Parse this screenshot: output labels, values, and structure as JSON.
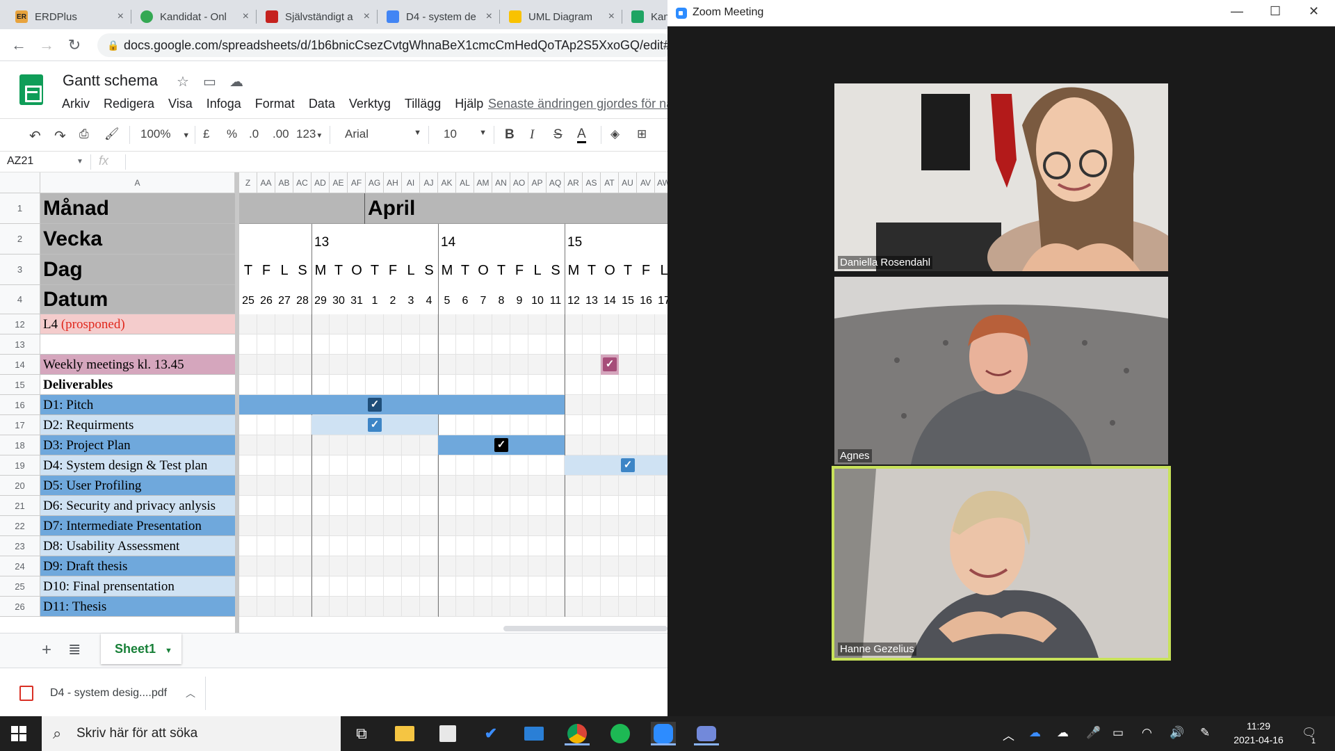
{
  "browser": {
    "tabs": [
      {
        "icon_text": "ER",
        "icon_color": "#e8a33d",
        "title": "ERDPlus"
      },
      {
        "icon_text": "",
        "icon_color": "#34a853",
        "title": "Kandidat - Onl"
      },
      {
        "icon_text": "",
        "icon_color": "#c5221f",
        "title": "Självständigt a"
      },
      {
        "icon_text": "",
        "icon_color": "#4285f4",
        "title": "D4 - system de"
      },
      {
        "icon_text": "",
        "icon_color": "#f9c200",
        "title": "UML Diagram"
      },
      {
        "icon_text": "",
        "icon_color": "#1fa463",
        "title": "Kan"
      }
    ],
    "url": "docs.google.com/spreadsheets/d/1b6bnicCsezCvtgWhnaBeX1cmcCmHedQoTAp2S5XxoGQ/edit#gid="
  },
  "sheets": {
    "doc_title": "Gantt schema",
    "menu": [
      "Arkiv",
      "Redigera",
      "Visa",
      "Infoga",
      "Format",
      "Data",
      "Verktyg",
      "Tillägg",
      "Hjälp"
    ],
    "last_edit": "Senaste ändringen gjordes för nå",
    "toolbar": {
      "zoom": "100%",
      "currency": "£",
      "percent": "%",
      "dec_less": ".0",
      "dec_more": ".00",
      "format": "123",
      "font": "Arial",
      "size": "10",
      "bold": "B",
      "italic": "I",
      "strike": "S",
      "text_color": "A"
    },
    "cell_ref": "AZ21",
    "fx": "fx",
    "col_a_label": "A",
    "col_headers": [
      "Z",
      "AA",
      "AB",
      "AC",
      "AD",
      "AE",
      "AF",
      "AG",
      "AH",
      "AI",
      "AJ",
      "AK",
      "AL",
      "AM",
      "AN",
      "AO",
      "AP",
      "AQ",
      "AR",
      "AS",
      "AT",
      "AU",
      "AV",
      "AW"
    ],
    "header_rows": [
      {
        "num": "1",
        "label": "Månad"
      },
      {
        "num": "2",
        "label": "Vecka"
      },
      {
        "num": "3",
        "label": "Dag"
      },
      {
        "num": "4",
        "label": "Datum"
      }
    ],
    "month": "April",
    "weeks": [
      {
        "label": "13",
        "col": 4
      },
      {
        "label": "14",
        "col": 11
      },
      {
        "label": "15",
        "col": 18
      }
    ],
    "days": [
      "T",
      "F",
      "L",
      "S",
      "M",
      "T",
      "O",
      "T",
      "F",
      "L",
      "S",
      "M",
      "T",
      "O",
      "T",
      "F",
      "L",
      "S",
      "M",
      "T",
      "O",
      "T",
      "F",
      "L"
    ],
    "dates": [
      "25",
      "26",
      "27",
      "28",
      "29",
      "30",
      "31",
      "1",
      "2",
      "3",
      "4",
      "5",
      "6",
      "7",
      "8",
      "9",
      "10",
      "11",
      "12",
      "13",
      "14",
      "15",
      "16",
      "17"
    ],
    "rows": [
      {
        "num": "12",
        "label": "L4 ",
        "label_extra": "(prosponed)",
        "bg": "#f4cccc",
        "extra_color": "#e0281d",
        "bold": false
      },
      {
        "num": "13",
        "label": "",
        "label_extra": "",
        "bg": "#ffffff",
        "extra_color": "",
        "bold": false
      },
      {
        "num": "14",
        "label": "Weekly meetings kl. 13.45",
        "label_extra": "",
        "bg": "#d5a6bd",
        "extra_color": "",
        "bold": false
      },
      {
        "num": "15",
        "label": "Deliverables",
        "label_extra": "",
        "bg": "#ffffff",
        "extra_color": "",
        "bold": true
      },
      {
        "num": "16",
        "label": "D1: Pitch",
        "label_extra": "",
        "bg": "#6fa8dc",
        "extra_color": "",
        "bold": false
      },
      {
        "num": "17",
        "label": "D2: Requirments",
        "label_extra": "",
        "bg": "#cfe2f3",
        "extra_color": "",
        "bold": false
      },
      {
        "num": "18",
        "label": "D3: Project Plan",
        "label_extra": "",
        "bg": "#6fa8dc",
        "extra_color": "",
        "bold": false
      },
      {
        "num": "19",
        "label": "D4: System design & Test plan",
        "label_extra": "",
        "bg": "#cfe2f3",
        "extra_color": "",
        "bold": false
      },
      {
        "num": "20",
        "label": "D5: User Profiling",
        "label_extra": "",
        "bg": "#6fa8dc",
        "extra_color": "",
        "bold": false
      },
      {
        "num": "21",
        "label": "D6: Security and privacy anlysis",
        "label_extra": "",
        "bg": "#cfe2f3",
        "extra_color": "",
        "bold": false
      },
      {
        "num": "22",
        "label": "D7: Intermediate Presentation",
        "label_extra": "",
        "bg": "#6fa8dc",
        "extra_color": "",
        "bold": false
      },
      {
        "num": "23",
        "label": "D8: Usability Assessment",
        "label_extra": "",
        "bg": "#cfe2f3",
        "extra_color": "",
        "bold": false
      },
      {
        "num": "24",
        "label": "D9: Draft thesis",
        "label_extra": "",
        "bg": "#6fa8dc",
        "extra_color": "",
        "bold": false
      },
      {
        "num": "25",
        "label": "D10: Final prensentation",
        "label_extra": "",
        "bg": "#cfe2f3",
        "extra_color": "",
        "bold": false
      },
      {
        "num": "26",
        "label": "D11: Thesis",
        "label_extra": "",
        "bg": "#6fa8dc",
        "extra_color": "",
        "bold": false
      }
    ],
    "bars": [
      {
        "row": 4,
        "from": 0,
        "to": 17,
        "color": "#6fa8dc"
      },
      {
        "row": 5,
        "from": 4,
        "to": 10,
        "color": "#cfe2f3"
      },
      {
        "row": 6,
        "from": 11,
        "to": 17,
        "color": "#6fa8dc"
      },
      {
        "row": 7,
        "from": 18,
        "to": 23,
        "color": "#cfe2f3"
      }
    ],
    "checks": [
      {
        "row": 2,
        "col": 20,
        "color": "#a64d79"
      },
      {
        "row": 4,
        "col": 7,
        "color": "#1f4e79"
      },
      {
        "row": 5,
        "col": 7,
        "color": "#3d85c6"
      },
      {
        "row": 6,
        "col": 14,
        "color": "#000000"
      },
      {
        "row": 7,
        "col": 21,
        "color": "#3d85c6"
      }
    ],
    "sheet_tab": "Sheet1"
  },
  "download": {
    "file": "D4 - system desig....pdf"
  },
  "zoom": {
    "title": "Zoom Meeting",
    "participants": [
      {
        "name": "Daniella Rosendahl"
      },
      {
        "name": "Agnes"
      },
      {
        "name": "Hanne Gezelius"
      }
    ]
  },
  "taskbar": {
    "search_placeholder": "Skriv här för att söka",
    "time": "11:29",
    "date": "2021-04-16",
    "notif_count": "1"
  }
}
